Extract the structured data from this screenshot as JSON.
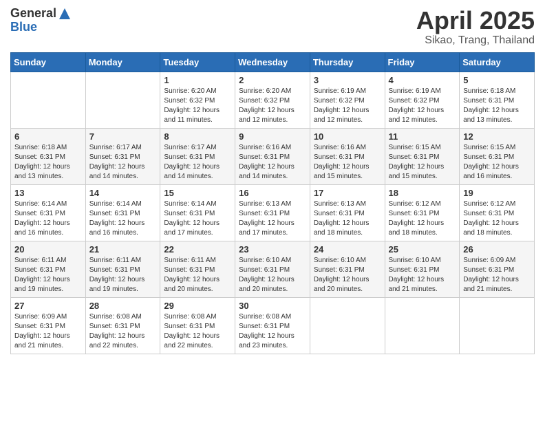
{
  "header": {
    "logo_general": "General",
    "logo_blue": "Blue",
    "title": "April 2025",
    "location": "Sikao, Trang, Thailand"
  },
  "weekdays": [
    "Sunday",
    "Monday",
    "Tuesday",
    "Wednesday",
    "Thursday",
    "Friday",
    "Saturday"
  ],
  "weeks": [
    [
      {
        "day": "",
        "info": ""
      },
      {
        "day": "",
        "info": ""
      },
      {
        "day": "1",
        "info": "Sunrise: 6:20 AM\nSunset: 6:32 PM\nDaylight: 12 hours and 11 minutes."
      },
      {
        "day": "2",
        "info": "Sunrise: 6:20 AM\nSunset: 6:32 PM\nDaylight: 12 hours and 12 minutes."
      },
      {
        "day": "3",
        "info": "Sunrise: 6:19 AM\nSunset: 6:32 PM\nDaylight: 12 hours and 12 minutes."
      },
      {
        "day": "4",
        "info": "Sunrise: 6:19 AM\nSunset: 6:32 PM\nDaylight: 12 hours and 12 minutes."
      },
      {
        "day": "5",
        "info": "Sunrise: 6:18 AM\nSunset: 6:31 PM\nDaylight: 12 hours and 13 minutes."
      }
    ],
    [
      {
        "day": "6",
        "info": "Sunrise: 6:18 AM\nSunset: 6:31 PM\nDaylight: 12 hours and 13 minutes."
      },
      {
        "day": "7",
        "info": "Sunrise: 6:17 AM\nSunset: 6:31 PM\nDaylight: 12 hours and 14 minutes."
      },
      {
        "day": "8",
        "info": "Sunrise: 6:17 AM\nSunset: 6:31 PM\nDaylight: 12 hours and 14 minutes."
      },
      {
        "day": "9",
        "info": "Sunrise: 6:16 AM\nSunset: 6:31 PM\nDaylight: 12 hours and 14 minutes."
      },
      {
        "day": "10",
        "info": "Sunrise: 6:16 AM\nSunset: 6:31 PM\nDaylight: 12 hours and 15 minutes."
      },
      {
        "day": "11",
        "info": "Sunrise: 6:15 AM\nSunset: 6:31 PM\nDaylight: 12 hours and 15 minutes."
      },
      {
        "day": "12",
        "info": "Sunrise: 6:15 AM\nSunset: 6:31 PM\nDaylight: 12 hours and 16 minutes."
      }
    ],
    [
      {
        "day": "13",
        "info": "Sunrise: 6:14 AM\nSunset: 6:31 PM\nDaylight: 12 hours and 16 minutes."
      },
      {
        "day": "14",
        "info": "Sunrise: 6:14 AM\nSunset: 6:31 PM\nDaylight: 12 hours and 16 minutes."
      },
      {
        "day": "15",
        "info": "Sunrise: 6:14 AM\nSunset: 6:31 PM\nDaylight: 12 hours and 17 minutes."
      },
      {
        "day": "16",
        "info": "Sunrise: 6:13 AM\nSunset: 6:31 PM\nDaylight: 12 hours and 17 minutes."
      },
      {
        "day": "17",
        "info": "Sunrise: 6:13 AM\nSunset: 6:31 PM\nDaylight: 12 hours and 18 minutes."
      },
      {
        "day": "18",
        "info": "Sunrise: 6:12 AM\nSunset: 6:31 PM\nDaylight: 12 hours and 18 minutes."
      },
      {
        "day": "19",
        "info": "Sunrise: 6:12 AM\nSunset: 6:31 PM\nDaylight: 12 hours and 18 minutes."
      }
    ],
    [
      {
        "day": "20",
        "info": "Sunrise: 6:11 AM\nSunset: 6:31 PM\nDaylight: 12 hours and 19 minutes."
      },
      {
        "day": "21",
        "info": "Sunrise: 6:11 AM\nSunset: 6:31 PM\nDaylight: 12 hours and 19 minutes."
      },
      {
        "day": "22",
        "info": "Sunrise: 6:11 AM\nSunset: 6:31 PM\nDaylight: 12 hours and 20 minutes."
      },
      {
        "day": "23",
        "info": "Sunrise: 6:10 AM\nSunset: 6:31 PM\nDaylight: 12 hours and 20 minutes."
      },
      {
        "day": "24",
        "info": "Sunrise: 6:10 AM\nSunset: 6:31 PM\nDaylight: 12 hours and 20 minutes."
      },
      {
        "day": "25",
        "info": "Sunrise: 6:10 AM\nSunset: 6:31 PM\nDaylight: 12 hours and 21 minutes."
      },
      {
        "day": "26",
        "info": "Sunrise: 6:09 AM\nSunset: 6:31 PM\nDaylight: 12 hours and 21 minutes."
      }
    ],
    [
      {
        "day": "27",
        "info": "Sunrise: 6:09 AM\nSunset: 6:31 PM\nDaylight: 12 hours and 21 minutes."
      },
      {
        "day": "28",
        "info": "Sunrise: 6:08 AM\nSunset: 6:31 PM\nDaylight: 12 hours and 22 minutes."
      },
      {
        "day": "29",
        "info": "Sunrise: 6:08 AM\nSunset: 6:31 PM\nDaylight: 12 hours and 22 minutes."
      },
      {
        "day": "30",
        "info": "Sunrise: 6:08 AM\nSunset: 6:31 PM\nDaylight: 12 hours and 23 minutes."
      },
      {
        "day": "",
        "info": ""
      },
      {
        "day": "",
        "info": ""
      },
      {
        "day": "",
        "info": ""
      }
    ]
  ]
}
